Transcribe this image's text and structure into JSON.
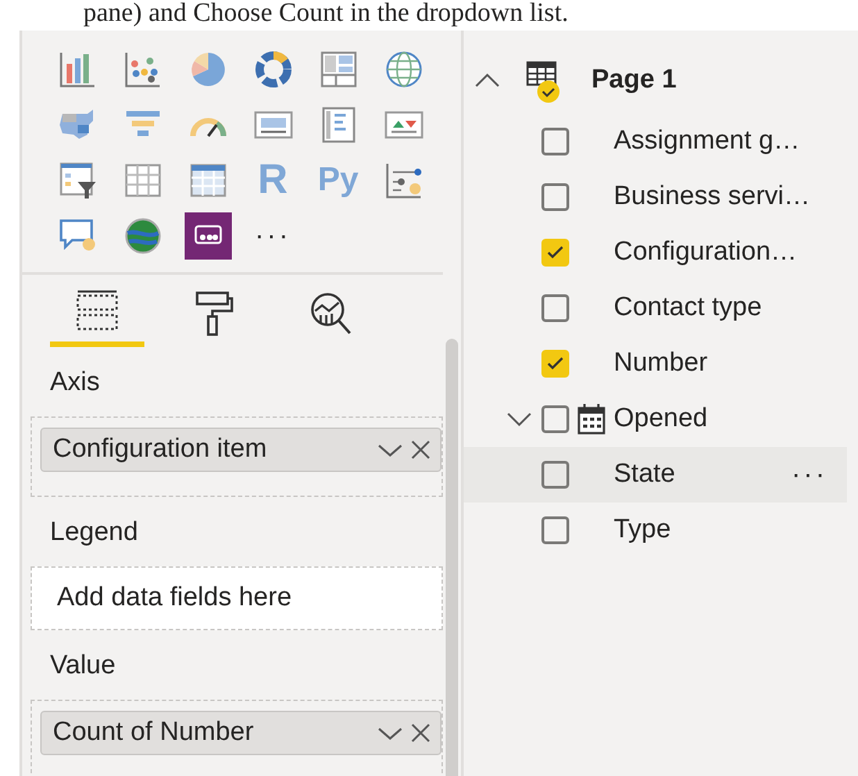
{
  "caption": "pane) and Choose Count in the dropdown list.",
  "script_visuals": [
    "R",
    "Py"
  ],
  "more_visuals": "···",
  "pane_tabs": [
    {
      "selected": true
    },
    {
      "selected": false
    },
    {
      "selected": false
    }
  ],
  "wells": [
    {
      "label": "Axis",
      "field": "Configuration item"
    },
    {
      "label": "Legend",
      "placeholder": "Add data fields here"
    },
    {
      "label": "Value",
      "field": "Count of Number"
    }
  ],
  "fields": {
    "table": "Page 1",
    "expanded": true,
    "items": [
      {
        "name": "Assignment g…",
        "checked": false
      },
      {
        "name": "Business servi…",
        "checked": false
      },
      {
        "name": "Configuration…",
        "checked": true
      },
      {
        "name": "Contact type",
        "checked": false
      },
      {
        "name": "Number",
        "checked": true
      },
      {
        "name": "Opened",
        "checked": false,
        "kind": "date",
        "expanded": false
      },
      {
        "name": "State",
        "checked": false,
        "hovered": true,
        "more": "···"
      },
      {
        "name": "Type",
        "checked": false
      }
    ]
  }
}
